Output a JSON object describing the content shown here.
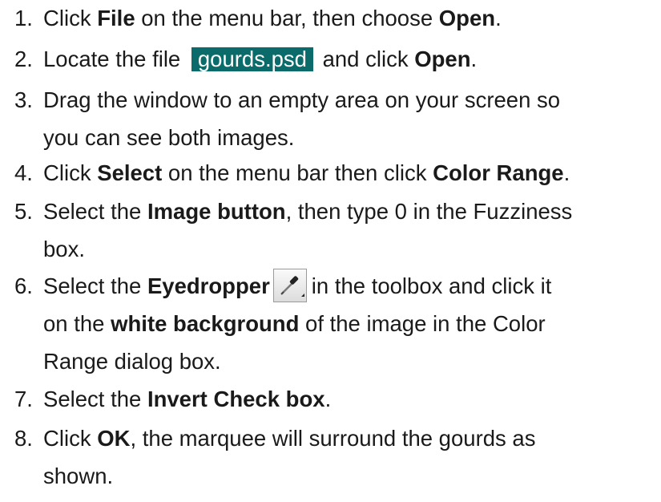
{
  "steps": [
    {
      "num": "1.",
      "lines": [
        [
          "Click ",
          {
            "b": "File"
          },
          " on the menu bar, then choose ",
          {
            "b": "Open"
          },
          "."
        ]
      ]
    },
    {
      "num": "2.",
      "lines": [
        [
          "Locate the file ",
          {
            "hl": "gourds.psd"
          },
          " and click ",
          {
            "b": "Open"
          },
          "."
        ]
      ]
    },
    {
      "num": "3.",
      "lines": [
        [
          "Drag the window to an empty area on your screen so"
        ],
        [
          "you can see both images."
        ]
      ]
    },
    {
      "num": "4.",
      "lines": [
        [
          "Click ",
          {
            "b": "Select"
          },
          " on the menu bar then click ",
          {
            "b": "Color Range"
          },
          "."
        ]
      ]
    },
    {
      "num": "5.",
      "lines": [
        [
          "Select the ",
          {
            "b": "Image button"
          },
          ", then type 0 in the Fuzziness"
        ],
        [
          "box."
        ]
      ]
    },
    {
      "num": "6.",
      "lines": [
        [
          "Select the ",
          {
            "b": "Eyedropper"
          },
          {
            "icon": "eyedropper-icon"
          },
          "in the toolbox and click it"
        ],
        [
          "on the ",
          {
            "b": "white background"
          },
          " of the image in the Color"
        ],
        [
          "Range dialog box."
        ]
      ]
    },
    {
      "num": "7.",
      "lines": [
        [
          "Select the ",
          {
            "b": "Invert Check box"
          },
          "."
        ]
      ]
    },
    {
      "num": "8.",
      "lines": [
        [
          "Click ",
          {
            "b": "OK"
          },
          ", the marquee will surround the gourds as"
        ],
        [
          "shown."
        ]
      ]
    }
  ],
  "colors": {
    "highlight": "#0b6b6b",
    "text": "#1a1a1a"
  }
}
